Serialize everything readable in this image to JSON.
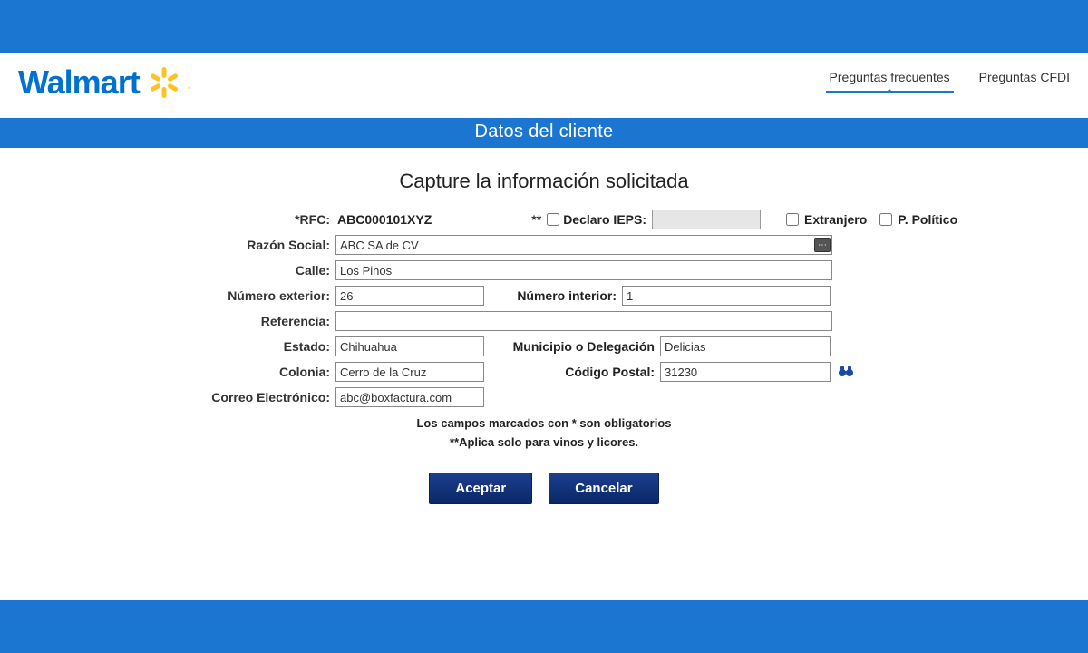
{
  "brand": {
    "name": "Walmart"
  },
  "nav": {
    "faq": "Preguntas frecuentes",
    "cfdi": "Preguntas CFDI"
  },
  "section_title": "Datos del cliente",
  "form": {
    "heading": "Capture la información solicitada",
    "labels": {
      "rfc": "*RFC:",
      "declare_ieps": "Declaro IEPS:",
      "foreign": "Extranjero",
      "political": "P. Político",
      "razon_social": "Razón Social:",
      "calle": "Calle:",
      "num_ext": "Número exterior:",
      "num_int": "Número interior:",
      "referencia": "Referencia:",
      "estado": "Estado:",
      "municipio": "Municipio o Delegación",
      "colonia": "Colonia:",
      "cp": "Código Postal:",
      "email": "Correo Electrónico:"
    },
    "values": {
      "rfc": "ABC000101XYZ",
      "razon_social": "ABC SA de CV",
      "calle": "Los Pinos",
      "num_ext": "26",
      "num_int": "1",
      "referencia": "",
      "estado": "Chihuahua",
      "municipio": "Delicias",
      "colonia": "Cerro de la Cruz",
      "cp": "31230",
      "email": "abc@boxfactura.com"
    },
    "asterisks": "**",
    "note1": "Los campos marcados con * son obligatorios",
    "note2": "**Aplica solo para vinos y licores."
  },
  "buttons": {
    "accept": "Aceptar",
    "cancel": "Cancelar"
  }
}
